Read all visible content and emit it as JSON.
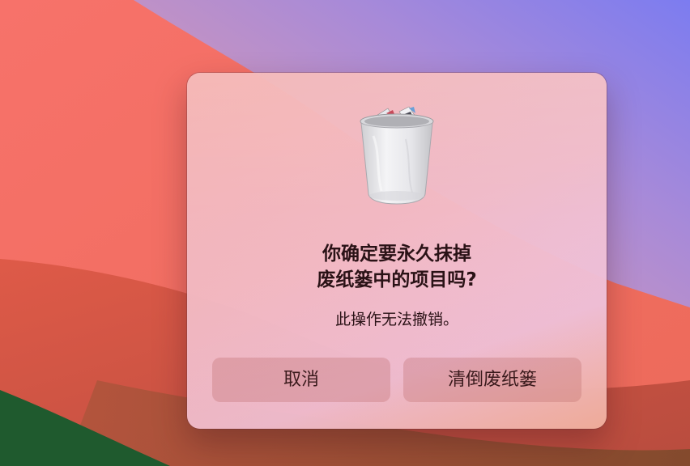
{
  "dialog": {
    "title_line1": "你确定要永久抹掉",
    "title_line2": "废纸篓中的项目吗?",
    "message": "此操作无法撤销。",
    "icon": "trash-full-icon"
  },
  "buttons": {
    "cancel_label": "取消",
    "empty_label": "清倒废纸篓"
  },
  "colors": {
    "wallpaper_red": "#f26a5c",
    "wallpaper_purple": "#8a7ae8",
    "wallpaper_green": "#1f5a2e",
    "dialog_tint": "#f2b8bc",
    "button_bg": "#d89a94",
    "text": "#2a1216"
  }
}
